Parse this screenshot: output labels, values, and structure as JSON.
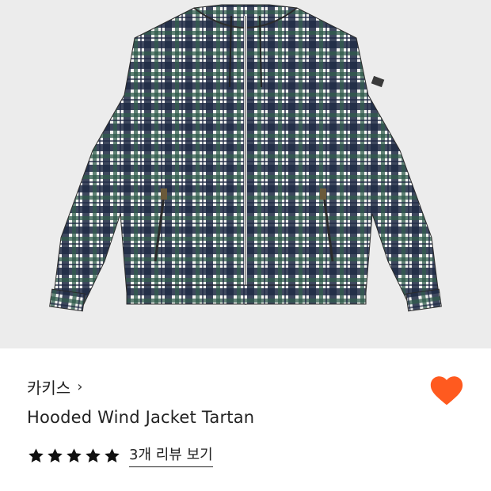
{
  "product": {
    "image_alt": "Hooded Wind Jacket Tartan product photo",
    "brand": "카키스",
    "brand_chevron": "›",
    "title": "Hooded Wind Jacket Tartan",
    "rating_stars": 5,
    "review_link": "3개 리뷰 보기",
    "favorited": true
  },
  "colors": {
    "image_background": "#ececec",
    "heart": "#ff5a1f",
    "star": "#111111",
    "text": "#222222",
    "tartan_navy": "#1f2a44",
    "tartan_green": "#2f5a4a",
    "tartan_white": "#f4f4f2"
  },
  "icons": {
    "brand_chevron": "chevron-right-icon",
    "favorite": "heart-icon",
    "star": "star-icon"
  }
}
